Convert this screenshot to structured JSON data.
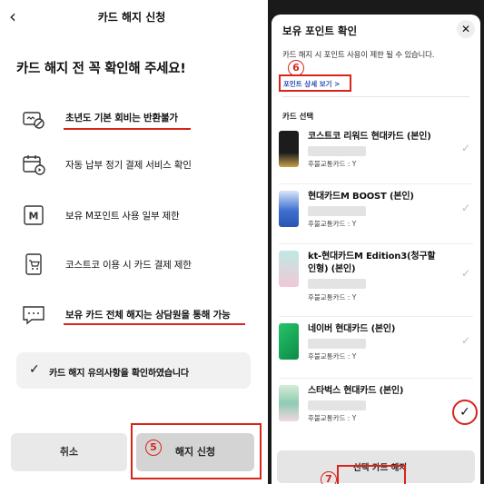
{
  "left": {
    "back_icon": "chevron-left-icon",
    "title": "카드 해지 신청",
    "headline": "카드 해지 전 꼭 확인해 주세요!",
    "items": [
      {
        "icon": "card-fee-icon",
        "text": "초년도 기본 회비는 반환불가"
      },
      {
        "icon": "calendar-payment-icon",
        "text": "자동 납부 정기 결제 서비스 확인"
      },
      {
        "icon": "m-point-icon",
        "text": "보유 M포인트 사용 일부 제한"
      },
      {
        "icon": "cart-icon",
        "text": "코스트코 이용 시 카드 결제 제한"
      },
      {
        "icon": "chat-bubble-icon",
        "text": "보유 카드 전체 해지는 상담원을 통해 가능"
      }
    ],
    "confirm_text": "카드 해지 유의사항을 확인하였습니다",
    "cancel_label": "취소",
    "apply_label": "해지 신청",
    "step_apply": "5"
  },
  "right": {
    "title": "보유 포인트 확인",
    "close_icon": "close-icon",
    "description": "카드 해지 시 포인트 사용이 제한 될 수 있습니다.",
    "step_point": "6",
    "point_link": "포인트 상세 보기 >",
    "section_label": "카드 선택",
    "cards": [
      {
        "name": "코스트코 리워드 현대카드 (본인)",
        "transit": "후불교통카드 : Y",
        "selected": false
      },
      {
        "name": "현대카드M BOOST (본인)",
        "transit": "후불교통카드 : Y",
        "selected": false
      },
      {
        "name_line1": "kt-현대카드M Edition3(청구할",
        "name_line2": "인형) (본인)",
        "transit": "후불교통카드 : Y",
        "selected": false
      },
      {
        "name": "네이버 현대카드 (본인)",
        "transit": "후불교통카드 : Y",
        "selected": false
      },
      {
        "name": "스타벅스 현대카드 (본인)",
        "transit": "후불교통카드 : Y",
        "selected": true
      }
    ],
    "submit_label": "선택 카드 해지",
    "step_submit": "7"
  },
  "colors": {
    "accent_red": "#d9241c",
    "link_blue": "#2a4fb0"
  }
}
